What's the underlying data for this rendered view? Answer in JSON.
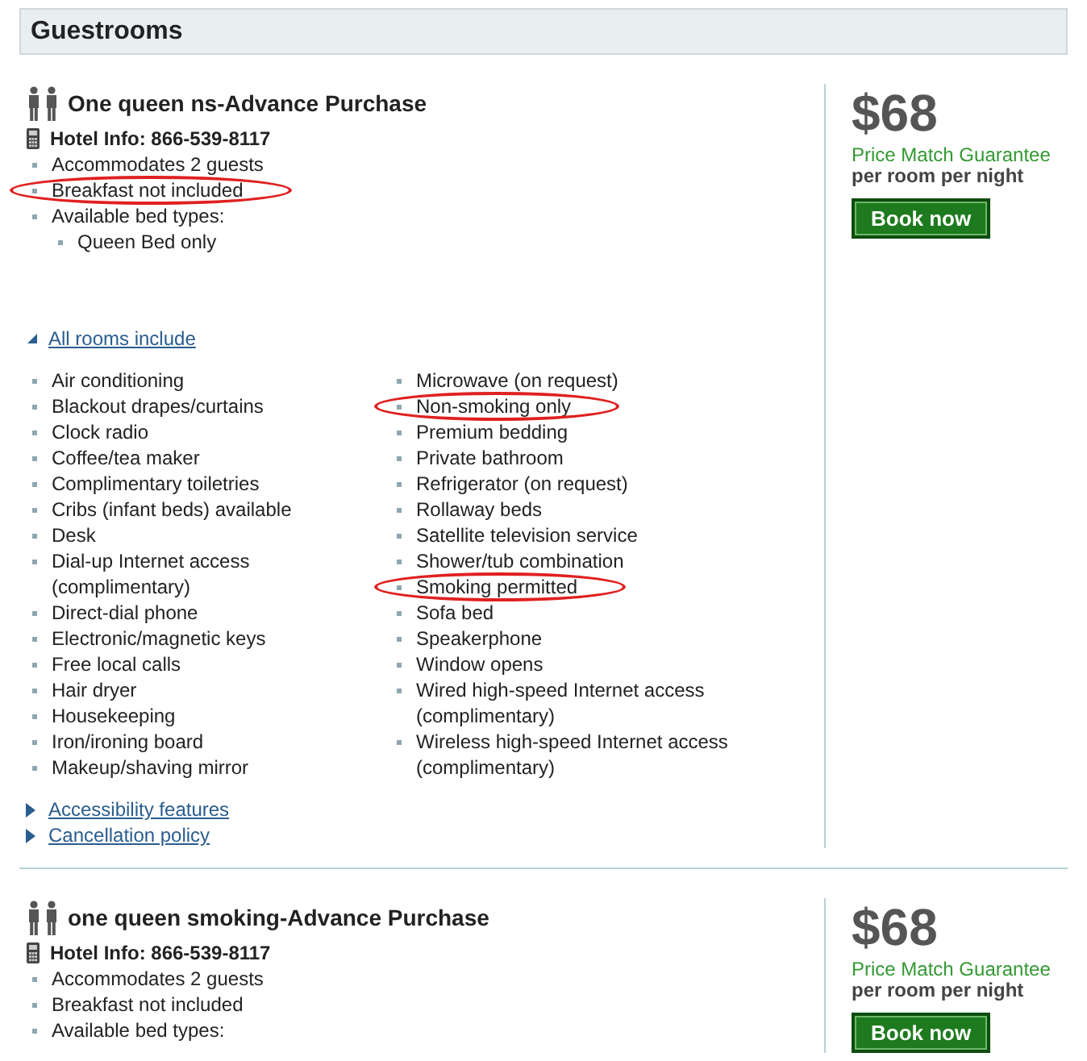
{
  "header": {
    "title": "Guestrooms"
  },
  "rooms": [
    {
      "name": "One queen ns-Advance Purchase",
      "hotel_info": "Hotel Info: 866-539-8117",
      "details": [
        {
          "text": "Accommodates 2 guests",
          "circled": false
        },
        {
          "text": "Breakfast not included",
          "circled": true
        },
        {
          "text": "Available bed types:",
          "circled": false,
          "children": [
            {
              "text": "Queen Bed only",
              "circled": false
            }
          ]
        }
      ],
      "amenities": {
        "toggle": {
          "label": "All rooms include",
          "expanded": true
        },
        "column_1": [
          {
            "text": "Air conditioning",
            "circled": false
          },
          {
            "text": "Blackout drapes/curtains",
            "circled": false
          },
          {
            "text": "Clock radio",
            "circled": false
          },
          {
            "text": "Coffee/tea maker",
            "circled": false
          },
          {
            "text": "Complimentary toiletries",
            "circled": false
          },
          {
            "text": "Cribs (infant beds) available",
            "circled": false
          },
          {
            "text": "Desk",
            "circled": false
          },
          {
            "text": "Dial-up Internet access (complimentary)",
            "circled": false
          },
          {
            "text": "Direct-dial phone",
            "circled": false
          },
          {
            "text": "Electronic/magnetic keys",
            "circled": false
          },
          {
            "text": "Free local calls",
            "circled": false
          },
          {
            "text": "Hair dryer",
            "circled": false
          },
          {
            "text": "Housekeeping",
            "circled": false
          },
          {
            "text": "Iron/ironing board",
            "circled": false
          },
          {
            "text": "Makeup/shaving mirror",
            "circled": false
          }
        ],
        "column_2": [
          {
            "text": "Microwave (on request)",
            "circled": false
          },
          {
            "text": "Non-smoking only",
            "circled": true
          },
          {
            "text": "Premium bedding",
            "circled": false
          },
          {
            "text": "Private bathroom",
            "circled": false
          },
          {
            "text": "Refrigerator (on request)",
            "circled": false
          },
          {
            "text": "Rollaway beds",
            "circled": false
          },
          {
            "text": "Satellite television service",
            "circled": false
          },
          {
            "text": "Shower/tub combination",
            "circled": false
          },
          {
            "text": "Smoking permitted",
            "circled": true
          },
          {
            "text": "Sofa bed",
            "circled": false
          },
          {
            "text": "Speakerphone",
            "circled": false
          },
          {
            "text": "Window opens",
            "circled": false
          },
          {
            "text": "Wired high-speed Internet access (complimentary)",
            "circled": false
          },
          {
            "text": "Wireless high-speed Internet access (complimentary)",
            "circled": false
          }
        ]
      },
      "links": [
        {
          "label": "Accessibility features",
          "expanded": false
        },
        {
          "label": "Cancellation policy",
          "expanded": false
        }
      ],
      "price": "$68",
      "guarantee": "Price Match Guarantee",
      "per": "per room per night",
      "button": "Book now"
    },
    {
      "name": "one queen smoking-Advance Purchase",
      "hotel_info": "Hotel Info: 866-539-8117",
      "details": [
        {
          "text": "Accommodates 2 guests",
          "circled": false
        },
        {
          "text": "Breakfast not included",
          "circled": false
        },
        {
          "text": "Available bed types:",
          "circled": false
        }
      ],
      "price": "$68",
      "guarantee": "Price Match Guarantee",
      "per": "per room per night",
      "button": "Book now"
    }
  ]
}
